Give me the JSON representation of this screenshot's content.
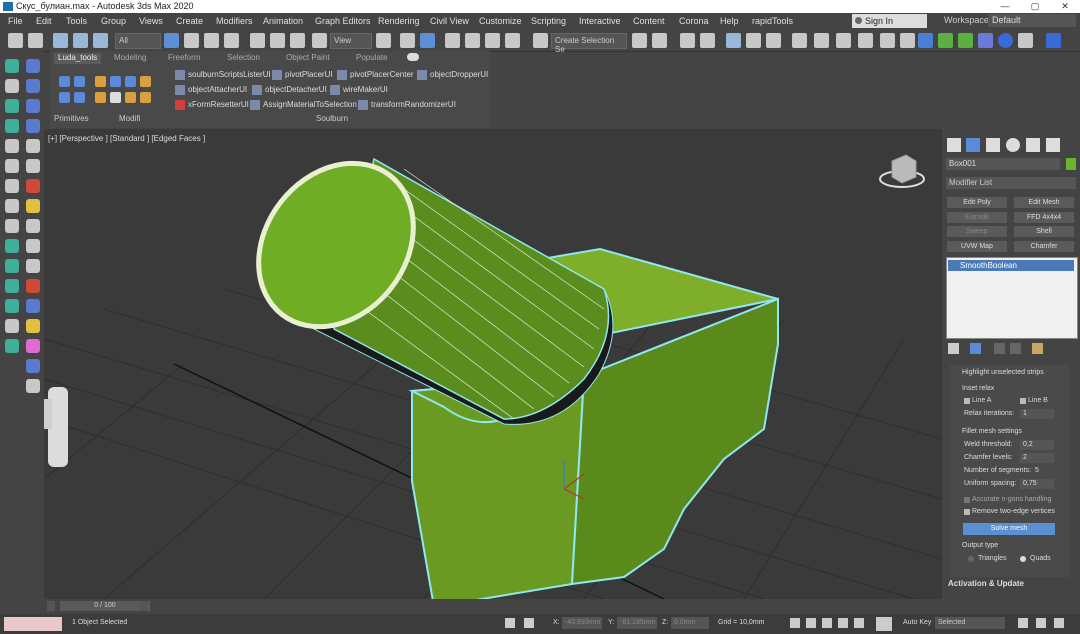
{
  "window": {
    "title": "Скус_булиан.max - Autodesk 3ds Max 2020",
    "minimize": "—",
    "maximize": "▢",
    "close": "✕"
  },
  "menu": [
    "File",
    "Edit",
    "Tools",
    "Group",
    "Views",
    "Create",
    "Modifiers",
    "Animation",
    "Graph Editors",
    "Rendering",
    "Civil View",
    "Customize",
    "Scripting",
    "Interactive",
    "Content",
    "Corona",
    "Help",
    "rapidTools"
  ],
  "signin": {
    "label": "Sign In"
  },
  "workspaces": {
    "label": "Workspaces:",
    "value": "Default"
  },
  "toolbar": {
    "filter": "All",
    "view": "View",
    "selection_set": "Create Selection Se"
  },
  "ribbon": {
    "tabs": [
      "Luda_tools",
      "Modeling",
      "Freeform",
      "Selection",
      "Object Paint",
      "Populate"
    ],
    "buttons": [
      "soulburnScriptsListerUI",
      "pivotPlacerUI",
      "pivotPlacerCenter",
      "objectDropperUI",
      "objectAttacherUI",
      "objectDetacherUI",
      "wireMakerUI",
      "xFormResetterUI",
      "AssignMaterialToSelection",
      "transformRandomizerUI"
    ],
    "sections": [
      "Primitives",
      "Modifi",
      "Soulburn"
    ]
  },
  "viewport": {
    "label": "[+] [Perspective ] [Standard ] [Edged Faces ]"
  },
  "command_panel": {
    "object_name": "Box001",
    "object_color": "#6ab52e",
    "modifier_list": "Modifier List",
    "mod_buttons": [
      "Edit Poly",
      "Edit Mesh",
      "Extrude",
      "FFD 4x4x4",
      "Sweep",
      "Shell",
      "UVW Map",
      "Chamfer"
    ],
    "stack_item": "SmoothBoolean",
    "rollout": {
      "highlight": "Highlight unselected strips",
      "inset_relax": "Inset relax",
      "line_a": "Line A",
      "line_b": "Line B",
      "relax_iterations_label": "Relax iterations:",
      "relax_iterations": "1",
      "fillet_settings": "Fillet mesh settings",
      "weld_label": "Weld threshold:",
      "weld": "0,2",
      "chamfer_label": "Chamfer levels:",
      "chamfer": "2",
      "segments_label": "Number of segments:",
      "segments": "5",
      "uniform_label": "Uniform spacing:",
      "uniform": "0,75",
      "accurate": "Accurate n-gons handling",
      "remove": "Remove two-edge vertices",
      "solve": "Solve mesh",
      "output_type": "Output type",
      "triangles": "Triangles",
      "quads": "Quads"
    },
    "activation": "Activation & Update"
  },
  "timeline": {
    "frame": "0 / 100"
  },
  "status": {
    "selected": "1 Object Selected",
    "x_label": "X:",
    "x": "-43,693mm",
    "y_label": "Y:",
    "y": "-81,185mm",
    "z_label": "Z:",
    "z": "0,0mm",
    "grid": "Grid = 10,0mm",
    "autokey": "Auto Key",
    "selected_dd": "Selected"
  }
}
